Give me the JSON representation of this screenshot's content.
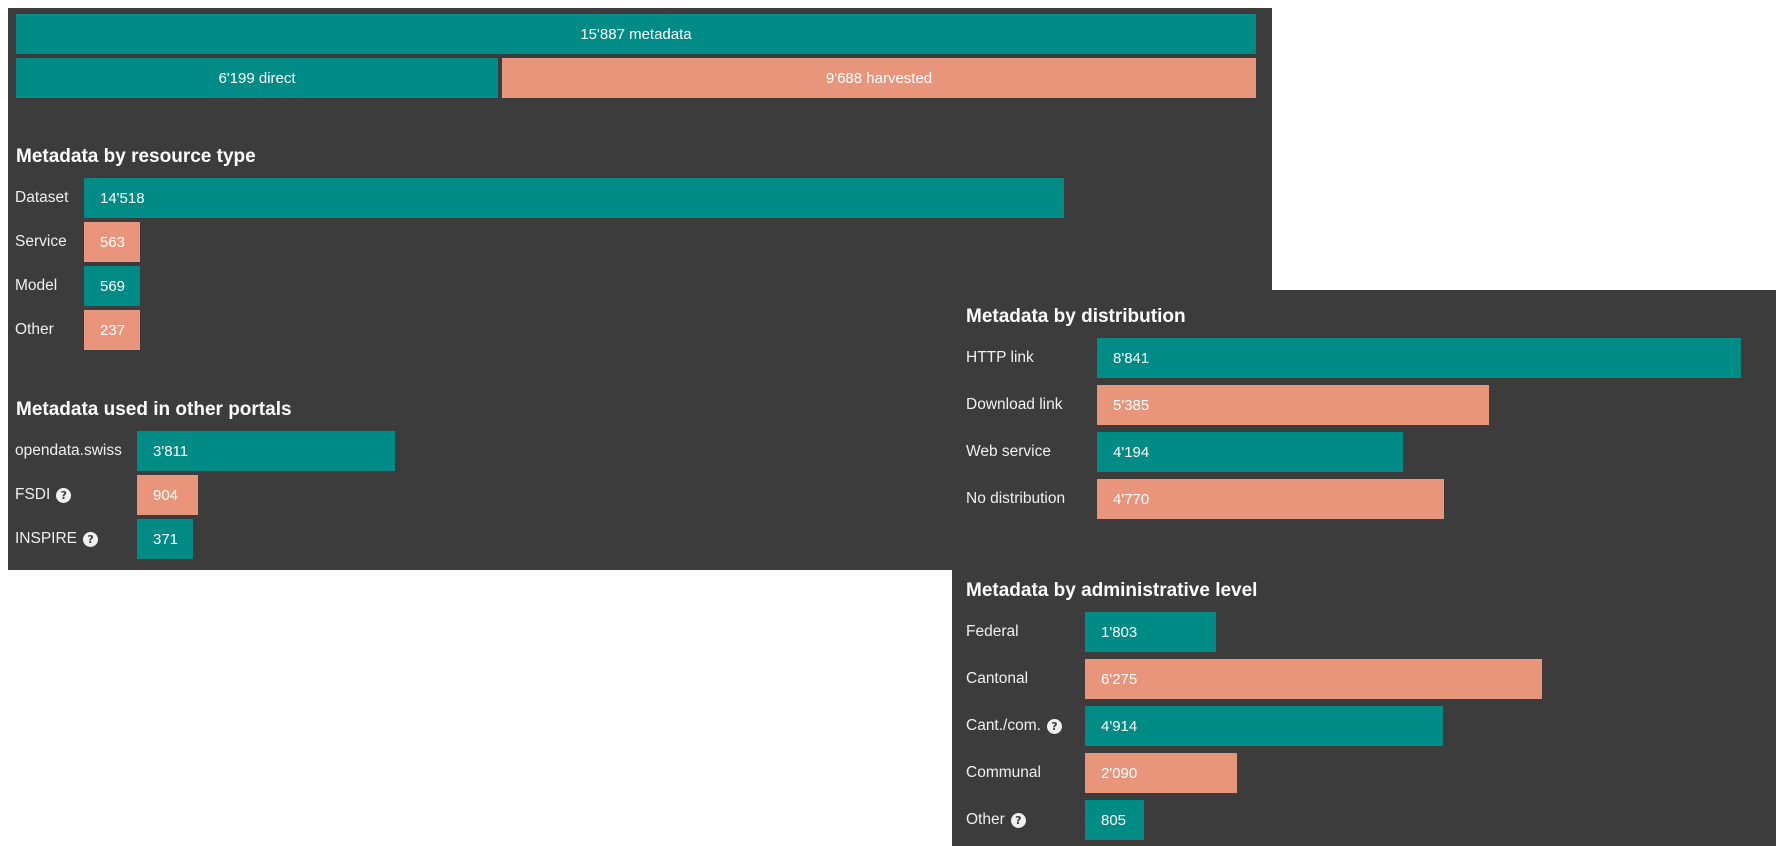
{
  "totals": {
    "total_label": "15'887 metadata",
    "direct_label": "6'199 direct",
    "harvested_label": "9'688 harvested",
    "total_value": 15887,
    "direct_value": 6199,
    "harvested_value": 9688
  },
  "resource_type": {
    "title": "Metadata by resource type",
    "rows": [
      {
        "label": "Dataset",
        "value_text": "14'518",
        "value": 14518
      },
      {
        "label": "Service",
        "value_text": "563",
        "value": 563
      },
      {
        "label": "Model",
        "value_text": "569",
        "value": 569
      },
      {
        "label": "Other",
        "value_text": "237",
        "value": 237
      }
    ]
  },
  "portals": {
    "title": "Metadata used in other portals",
    "rows": [
      {
        "label": "opendata.swiss",
        "value_text": "3'811",
        "value": 3811,
        "help": false
      },
      {
        "label": "FSDI",
        "value_text": "904",
        "value": 904,
        "help": true
      },
      {
        "label": "INSPIRE",
        "value_text": "371",
        "value": 371,
        "help": true
      }
    ]
  },
  "distribution": {
    "title": "Metadata by distribution",
    "rows": [
      {
        "label": "HTTP link",
        "value_text": "8'841",
        "value": 8841
      },
      {
        "label": "Download link",
        "value_text": "5'385",
        "value": 5385
      },
      {
        "label": "Web service",
        "value_text": "4'194",
        "value": 4194
      },
      {
        "label": "No distribution",
        "value_text": "4'770",
        "value": 4770
      }
    ]
  },
  "admin_level": {
    "title": "Metadata by administrative level",
    "rows": [
      {
        "label": "Federal",
        "value_text": "1'803",
        "value": 1803,
        "help": false
      },
      {
        "label": "Cantonal",
        "value_text": "6'275",
        "value": 6275,
        "help": false
      },
      {
        "label": "Cant./com.",
        "value_text": "4'914",
        "value": 4914,
        "help": true
      },
      {
        "label": "Communal",
        "value_text": "2'090",
        "value": 2090,
        "help": false
      },
      {
        "label": "Other",
        "value_text": "805",
        "value": 805,
        "help": true
      }
    ]
  },
  "icons": {
    "help": "question-circle-icon",
    "help_glyph": "?"
  },
  "colors": {
    "teal": "#008b87",
    "salmon": "#e8957b",
    "panel_bg": "#3c3c3c",
    "text": "#ffffff"
  }
}
